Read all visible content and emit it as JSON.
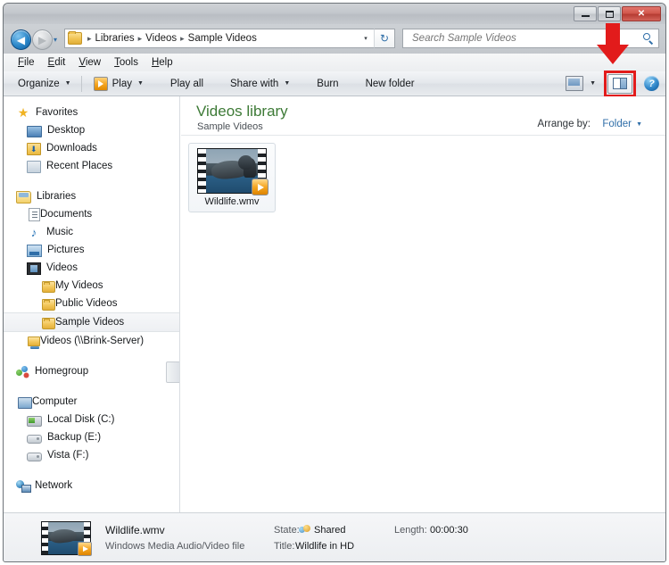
{
  "window": {
    "caption_buttons": [
      {
        "name": "minimize",
        "glyph": "—"
      },
      {
        "name": "maximize",
        "glyph": "❐"
      },
      {
        "name": "close",
        "glyph": "✕"
      }
    ]
  },
  "navbar": {
    "back_icon": "◀",
    "forward_icon": "▶",
    "recent_pages_icon": "▾",
    "breadcrumbs": [
      "Libraries",
      "Videos",
      "Sample Videos"
    ],
    "breadcrumb_separator": "▸",
    "address_dropdown_icon": "▾",
    "refresh_icon": "↻",
    "search": {
      "placeholder": "Search Sample Videos",
      "value": "",
      "icon": "search-icon"
    }
  },
  "menubar": {
    "items": [
      {
        "label": "File",
        "accel": "F",
        "rest": "ile"
      },
      {
        "label": "Edit",
        "accel": "E",
        "rest": "dit"
      },
      {
        "label": "View",
        "accel": "V",
        "rest": "iew"
      },
      {
        "label": "Tools",
        "accel": "T",
        "rest": "ools"
      },
      {
        "label": "Help",
        "accel": "H",
        "rest": "elp"
      }
    ]
  },
  "toolbar": {
    "organize": "Organize",
    "play": "Play",
    "play_all": "Play all",
    "share_with": "Share with",
    "burn": "Burn",
    "new_folder": "New folder",
    "caret": "▼",
    "view_mode_icon": "change-view-icon",
    "preview_pane_icon": "preview-pane-icon",
    "help_icon": "?"
  },
  "annotation": {
    "arrow_color": "#e21b1b",
    "highlight_color": "#e21b1b",
    "target": "preview-pane-button"
  },
  "navpane": {
    "groups": [
      {
        "header": {
          "label": "Favorites",
          "icon": "star-icon",
          "level": 0
        },
        "items": [
          {
            "label": "Desktop",
            "icon": "desktop-icon",
            "level": 1
          },
          {
            "label": "Downloads",
            "icon": "downloads-icon",
            "level": 1
          },
          {
            "label": "Recent Places",
            "icon": "recent-places-icon",
            "level": 1
          }
        ]
      },
      {
        "header": {
          "label": "Libraries",
          "icon": "libraries-icon",
          "level": 0
        },
        "items": [
          {
            "label": "Documents",
            "icon": "documents-icon",
            "level": 1
          },
          {
            "label": "Music",
            "icon": "music-icon",
            "level": 1
          },
          {
            "label": "Pictures",
            "icon": "pictures-icon",
            "level": 1
          },
          {
            "label": "Videos",
            "icon": "videos-icon",
            "level": 1
          },
          {
            "label": "My Videos",
            "icon": "folder-icon",
            "level": 2
          },
          {
            "label": "Public Videos",
            "icon": "folder-icon",
            "level": 2
          },
          {
            "label": "Sample Videos",
            "icon": "folder-icon",
            "level": 2,
            "selected": true
          },
          {
            "label": "Videos (\\\\Brink-Server)",
            "icon": "network-folder-icon",
            "level": 1
          }
        ]
      },
      {
        "header": {
          "label": "Homegroup",
          "icon": "homegroup-icon",
          "level": 0
        },
        "items": []
      },
      {
        "header": {
          "label": "Computer",
          "icon": "computer-icon",
          "level": 0
        },
        "items": [
          {
            "label": "Local Disk (C:)",
            "icon": "local-disk-icon",
            "level": 1
          },
          {
            "label": "Backup (E:)",
            "icon": "drive-icon",
            "level": 1
          },
          {
            "label": "Vista (F:)",
            "icon": "drive-icon",
            "level": 1
          }
        ]
      },
      {
        "header": {
          "label": "Network",
          "icon": "network-icon",
          "level": 0
        },
        "items": []
      }
    ]
  },
  "content": {
    "library_title": "Videos library",
    "library_subtitle": "Sample Videos",
    "arrange_by_label": "Arrange by:",
    "arrange_by_value": "Folder",
    "arrange_caret": "▼",
    "files": [
      {
        "name": "Wildlife.wmv",
        "type": "video",
        "thumbnail": "wildlife-seal-thumbnail"
      }
    ]
  },
  "details": {
    "file_name": "Wildlife.wmv",
    "file_type": "Windows Media Audio/Video file",
    "state_key": "State:",
    "state_value": "Shared",
    "state_icon": "shared-icon",
    "title_key": "Title:",
    "title_value": "Wildlife in HD",
    "length_key": "Length:",
    "length_value": "00:00:30"
  }
}
